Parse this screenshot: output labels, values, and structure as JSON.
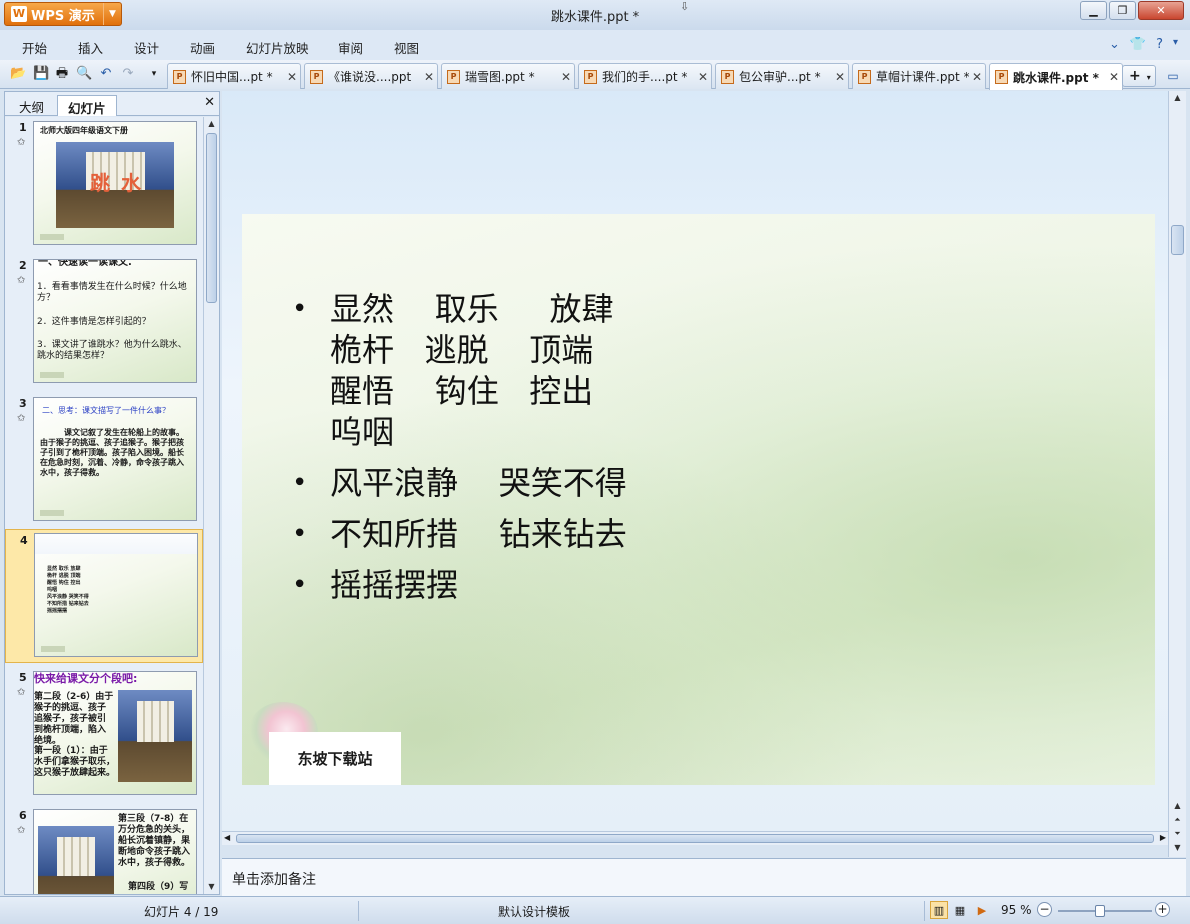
{
  "app": {
    "name": "WPS 演示",
    "window_title": "跳水课件.ppt *",
    "window_controls": {
      "minimize": "▁",
      "restore": "❐",
      "close": "✕"
    }
  },
  "menu": {
    "items": [
      "开始",
      "插入",
      "设计",
      "动画",
      "幻灯片放映",
      "审阅",
      "视图"
    ]
  },
  "doc_tabs": [
    {
      "label": "怀旧中国...pt *",
      "active": false
    },
    {
      "label": "《谁说没....ppt",
      "active": false
    },
    {
      "label": "瑞雪图.ppt *",
      "active": false
    },
    {
      "label": "我们的手....pt *",
      "active": false
    },
    {
      "label": "包公审驴...pt *",
      "active": false
    },
    {
      "label": "草帽计课件.ppt *",
      "active": false
    },
    {
      "label": "跳水课件.ppt *",
      "active": true
    }
  ],
  "left_pane": {
    "tabs": [
      "大纲",
      "幻灯片"
    ],
    "active_tab": "幻灯片",
    "thumbnails": [
      {
        "num": "1",
        "header": "北师大版四年级语文下册",
        "title": "跳 水"
      },
      {
        "num": "2",
        "lines": [
          "一、快速读一读课文.",
          "1．看看事情发生在什么时候？什么地方？",
          "2．这件事情是怎样引起的？",
          "3．课文讲了谁跳水？他为什么跳水、跳水的结果怎样？"
        ]
      },
      {
        "num": "3",
        "lines": [
          "二、思考：课文描写了一件什么事？",
          "课文记叙了发生在轮船上的故事。由于猴子的挑逗、孩子追猴子。猴子把孩子引到了桅杆顶端。孩子陷入困境。船长在危急时刻，沉着、冷静，命令孩子跳入水中，孩子得救。"
        ]
      },
      {
        "num": "4",
        "lines": [
          "显然 取乐 放肆",
          "桅杆 逃脱 顶端",
          "醒悟 钩住 控出",
          "呜咽",
          "风平浪静 哭笑不得",
          "不知所措 钻来钻去",
          "摇摇摆摆"
        ]
      },
      {
        "num": "5",
        "lines": [
          "快来给课文分个段吧:",
          "第二段（2-6）由于猴子的挑逗、孩子追猴子，孩子被引到桅杆顶端，陷入绝境。",
          "第一段（1）：由于水手们拿猴子取乐，这只猴子放肆起来。"
        ]
      },
      {
        "num": "6",
        "lines": [
          "第三段（7-8）在万分危急的关头，船长沉着镇静，果断地命令孩子跳入水中，孩子得救。",
          "第四段（9）写"
        ]
      }
    ]
  },
  "slide": {
    "bullets": [
      {
        "lines": [
          "显然    取乐     放肆",
          "桅杆   逃脱    顶端",
          "醒悟    钩住   控出",
          "呜咽"
        ]
      },
      {
        "lines": [
          "风平浪静    哭笑不得"
        ]
      },
      {
        "lines": [
          "不知所措    钻来钻去"
        ]
      },
      {
        "lines": [
          "摇摇摆摆"
        ]
      }
    ],
    "footer": "东坡下载站"
  },
  "notes_placeholder": "单击添加备注",
  "status": {
    "slide_position": "幻灯片 4 / 19",
    "template": "默认设计模板",
    "zoom": "95 %",
    "zoom_fraction": 0.45
  }
}
